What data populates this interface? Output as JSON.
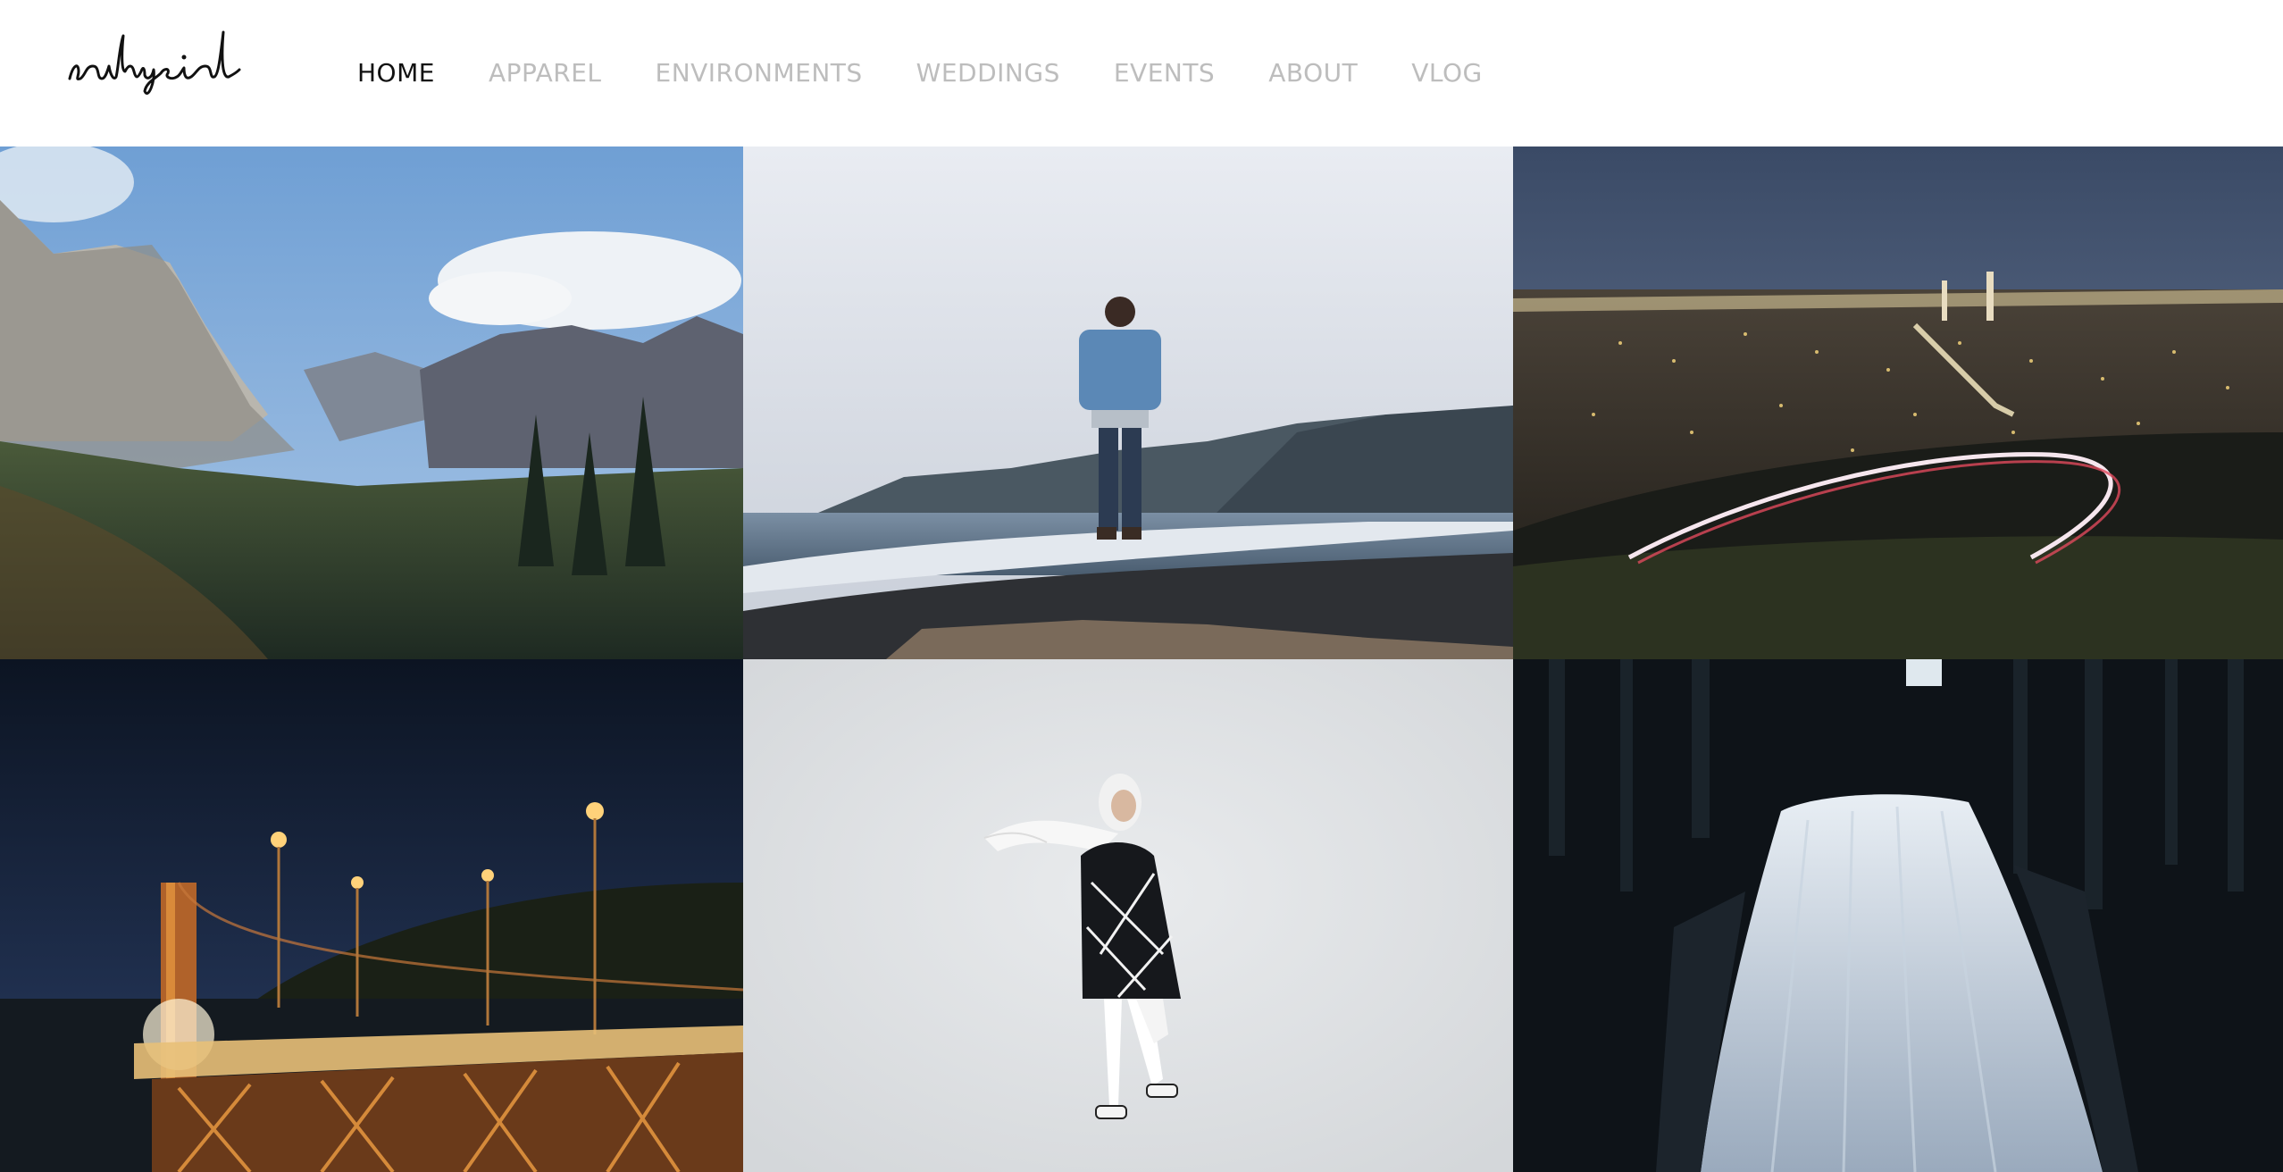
{
  "logo": {
    "text": "rahysid"
  },
  "nav": {
    "items": [
      {
        "label": "HOME",
        "active": true
      },
      {
        "label": "APPAREL",
        "active": false
      },
      {
        "label": "ENVIRONMENTS",
        "active": false
      },
      {
        "label": "WEDDINGS",
        "active": false
      },
      {
        "label": "EVENTS",
        "active": false
      },
      {
        "label": "ABOUT",
        "active": false
      },
      {
        "label": "VLOG",
        "active": false
      }
    ]
  },
  "gallery": {
    "photos": [
      {
        "subject": "mountain-valley-photo"
      },
      {
        "subject": "man-on-beach-photo"
      },
      {
        "subject": "city-lights-night-photo"
      },
      {
        "subject": "golden-gate-bridge-night-photo"
      },
      {
        "subject": "woman-with-scarf-photo"
      },
      {
        "subject": "waterfall-forest-photo"
      }
    ]
  },
  "colors": {
    "nav_active": "#111111",
    "nav_inactive": "#bdbdbd",
    "background": "#ffffff"
  }
}
